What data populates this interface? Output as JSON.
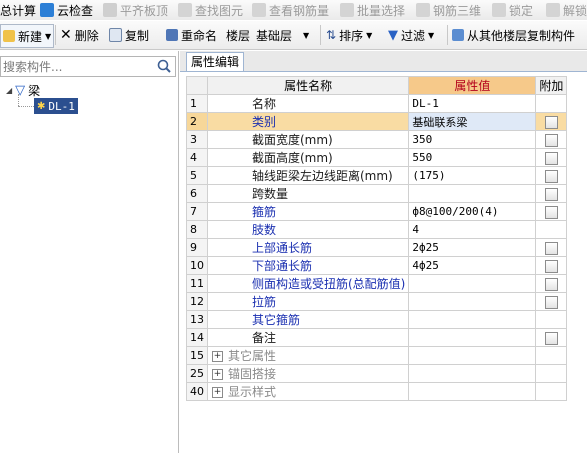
{
  "toolbar_top": {
    "items": [
      {
        "label": "总计算",
        "icon": "calculator-icon",
        "disabled": false
      },
      {
        "label": "云检查",
        "icon": "cloud-check-icon",
        "disabled": false
      },
      {
        "label": "平齐板顶",
        "icon": "align-slab-top-icon",
        "disabled": true
      },
      {
        "label": "查找图元",
        "icon": "find-element-icon",
        "disabled": true
      },
      {
        "label": "查看钢筋量",
        "icon": "view-rebar-icon",
        "disabled": true
      },
      {
        "label": "批量选择",
        "icon": "batch-select-icon",
        "disabled": true
      },
      {
        "label": "钢筋三维",
        "icon": "rebar-3d-icon",
        "disabled": true
      },
      {
        "label": "锁定",
        "icon": "lock-icon",
        "disabled": true
      },
      {
        "label": "解锁",
        "icon": "unlock-icon",
        "disabled": true
      }
    ]
  },
  "toolbar_main": {
    "new_label": "新建",
    "delete_label": "删除",
    "copy_label": "复制",
    "rename_label": "重命名",
    "floor_label": "楼层",
    "floor_value": "基础层",
    "sort_label": "排序",
    "filter_label": "过滤",
    "copy_from_floor_label": "从其他楼层复制构件"
  },
  "left_panel": {
    "search_placeholder": "搜索构件...",
    "tree": {
      "root_label": "梁",
      "child_label": "DL-1"
    }
  },
  "right_panel": {
    "tab_label": "属性编辑",
    "headers": {
      "name": "属性名称",
      "value": "属性值",
      "extra": "附加"
    },
    "rows": [
      {
        "idx": "1",
        "name": "名称",
        "value": "DL-1",
        "color": "default",
        "checkbox": false
      },
      {
        "idx": "2",
        "name": "类别",
        "value": "基础联系梁",
        "color": "blue",
        "checkbox": true,
        "selected": true
      },
      {
        "idx": "3",
        "name": "截面宽度(mm)",
        "value": "350",
        "color": "default",
        "checkbox": true
      },
      {
        "idx": "4",
        "name": "截面高度(mm)",
        "value": "550",
        "color": "default",
        "checkbox": true
      },
      {
        "idx": "5",
        "name": "轴线距梁左边线距离(mm)",
        "value": "(175)",
        "color": "default",
        "checkbox": true
      },
      {
        "idx": "6",
        "name": "跨数量",
        "value": "",
        "color": "default",
        "checkbox": true
      },
      {
        "idx": "7",
        "name": "箍筋",
        "value": "ф8@100/200(4)",
        "color": "blue",
        "checkbox": true
      },
      {
        "idx": "8",
        "name": "肢数",
        "value": "4",
        "color": "blue",
        "checkbox": false
      },
      {
        "idx": "9",
        "name": "上部通长筋",
        "value": "2ф25",
        "color": "blue",
        "checkbox": true
      },
      {
        "idx": "10",
        "name": "下部通长筋",
        "value": "4ф25",
        "color": "blue",
        "checkbox": true
      },
      {
        "idx": "11",
        "name": "侧面构造或受扭筋(总配筋值)",
        "value": "",
        "color": "blue",
        "checkbox": true
      },
      {
        "idx": "12",
        "name": "拉筋",
        "value": "",
        "color": "blue",
        "checkbox": true
      },
      {
        "idx": "13",
        "name": "其它箍筋",
        "value": "",
        "color": "blue",
        "checkbox": false
      },
      {
        "idx": "14",
        "name": "备注",
        "value": "",
        "color": "default",
        "checkbox": true
      },
      {
        "idx": "15",
        "name": "其它属性",
        "value": "",
        "color": "gray",
        "checkbox": false,
        "expander": "+"
      },
      {
        "idx": "25",
        "name": "锚固搭接",
        "value": "",
        "color": "gray",
        "checkbox": false,
        "expander": "+"
      },
      {
        "idx": "40",
        "name": "显示样式",
        "value": "",
        "color": "gray",
        "checkbox": false,
        "expander": "+"
      }
    ]
  },
  "colors": {
    "header_value_bg": "#f6c98a",
    "header_value_text": "#b3001b",
    "blue_text": "#1a2fb0",
    "selected_row": "#f9dca3"
  }
}
